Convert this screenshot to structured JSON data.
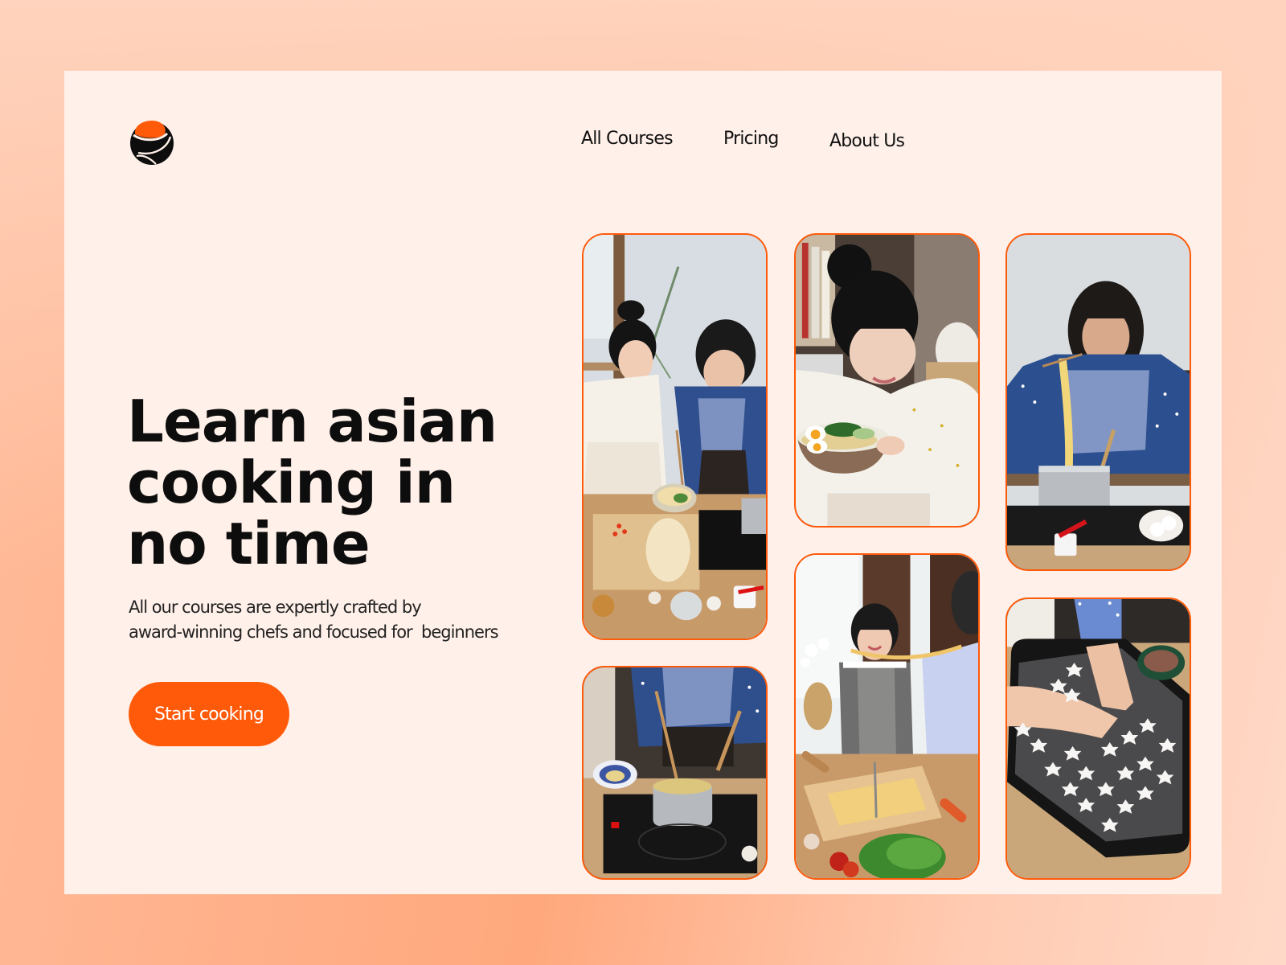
{
  "brand": {
    "logo_icon": "sushi-roll-logo",
    "accent_color": "#ff5a0a",
    "frame_background": "#fff0e9"
  },
  "nav": {
    "items": [
      {
        "label": "All Courses"
      },
      {
        "label": "Pricing"
      },
      {
        "label": "About Us"
      }
    ]
  },
  "hero": {
    "title_lines": [
      "Learn asian",
      "cooking in",
      "no time"
    ],
    "subtitle_lines": [
      "All our courses are expertly crafted by",
      "award-winning chefs and focused for  beginners"
    ],
    "cta_label": "Start cooking"
  },
  "gallery": {
    "images": [
      {
        "alt": "Two women preparing noodles with bok choy on a cutting board"
      },
      {
        "alt": "Smiling woman holding a bowl of ramen with boiled eggs"
      },
      {
        "alt": "Woman lifting noodles out of a steel pot with chopsticks"
      },
      {
        "alt": "Cooking noodles in a saucepan on an induction stove"
      },
      {
        "alt": "Women laughing while stretching fresh dough noodles"
      },
      {
        "alt": "Hands sprinkling dried petals over star-shaped meringues on a baking tray"
      }
    ]
  }
}
